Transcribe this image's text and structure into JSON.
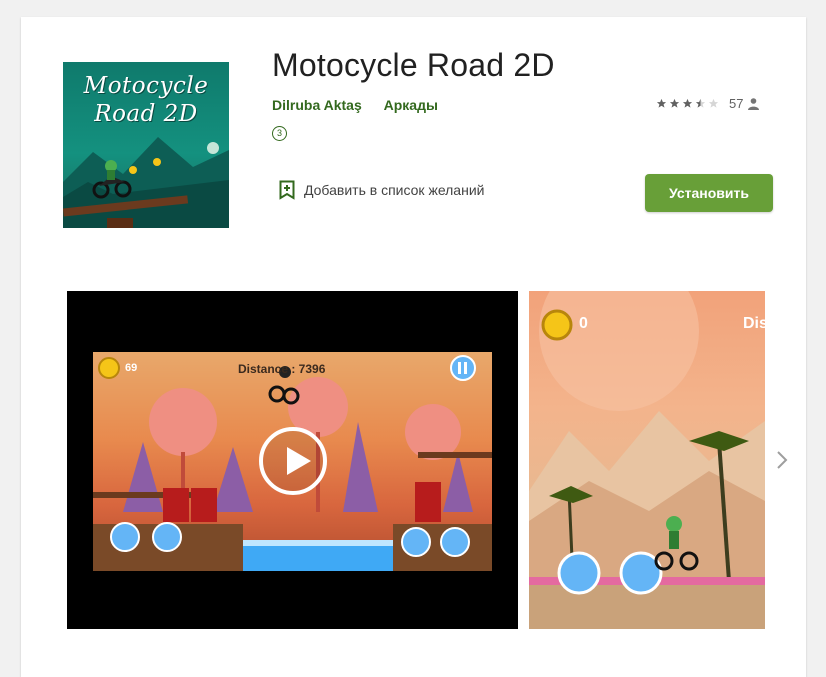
{
  "app": {
    "title": "Motocycle Road 2D",
    "developer": "Dilruba Aktaş",
    "genre": "Аркады",
    "content_rating": "3",
    "rating_count": "57",
    "rating_stars": 3.5,
    "wishlist_label": "Добавить в список желаний",
    "install_label": "Установить",
    "icon_text": "Motocycle\nRoad 2D"
  },
  "screenshots": {
    "shot1": {
      "coins": "69",
      "distance": "Distance : 7396"
    },
    "shot2": {
      "coins": "0",
      "distance_partial": "Dis"
    }
  },
  "colors": {
    "accent": "#689f38",
    "link": "#33691e",
    "title": "#212121"
  },
  "icons": {
    "wishlist": "bookmark-plus-icon",
    "rating_user": "person-icon",
    "next": "chevron-right-icon",
    "play": "play-icon"
  }
}
